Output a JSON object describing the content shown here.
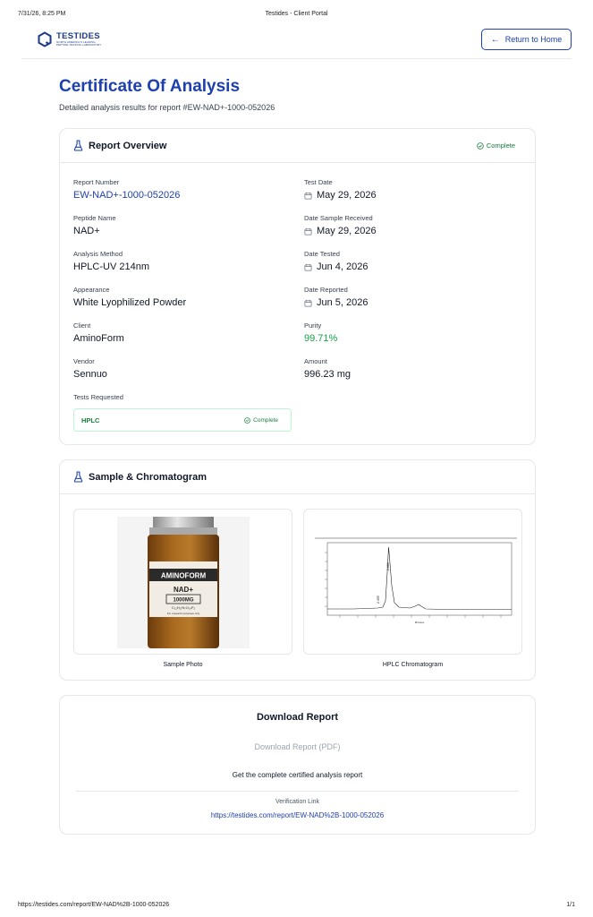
{
  "print": {
    "timestamp": "7/31/26, 8:25 PM",
    "title": "Testides - Client Portal",
    "url": "https://testides.com/report/EW-NAD%2B-1000-052026",
    "page": "1/1"
  },
  "nav": {
    "logo_name": "TESTIDES",
    "logo_tagline_1": "NORTH AMERICA'S LEADING",
    "logo_tagline_2": "PEPTIDE TESTING LABORATORY",
    "return_label": "Return to Home"
  },
  "page": {
    "title": "Certificate Of Analysis",
    "subtitle": "Detailed analysis results for report #EW-NAD+-1000-052026"
  },
  "overview": {
    "title": "Report Overview",
    "status": "Complete",
    "report_number_label": "Report Number",
    "report_number": "EW-NAD+-1000-052026",
    "peptide_label": "Peptide Name",
    "peptide": "NAD+",
    "method_label": "Analysis Method",
    "method": "HPLC-UV 214nm",
    "appearance_label": "Appearance",
    "appearance": "White Lyophilized Powder",
    "client_label": "Client",
    "client": "AminoForm",
    "vendor_label": "Vendor",
    "vendor": "Sennuo",
    "tests_label": "Tests Requested",
    "test_date_label": "Test Date",
    "test_date": "May 29, 2026",
    "received_label": "Date Sample Received",
    "received": "May 29, 2026",
    "tested_label": "Date Tested",
    "tested": "Jun 4, 2026",
    "reported_label": "Date Reported",
    "reported": "Jun 5, 2026",
    "purity_label": "Purity",
    "purity": "99.71%",
    "amount_label": "Amount",
    "amount": "996.23 mg",
    "test": {
      "name": "HPLC",
      "status": "Complete"
    }
  },
  "sample": {
    "title": "Sample & Chromatogram",
    "photo_caption": "Sample Photo",
    "chrom_caption": "HPLC Chromatogram",
    "vial_brand": "AMINOFORM",
    "vial_product": "NAD+",
    "vial_dose": "1000MG",
    "vial_formula": "C₂₁H₂₇N₇O₁₄P₂",
    "vial_note": "For research purposes only",
    "peak_label_main": "2.880",
    "peak_label_minor": "2.459",
    "x_axis_label": "Minutes"
  },
  "download": {
    "title": "Download Report",
    "button": "Download Report (PDF)",
    "description": "Get the complete certified analysis report",
    "verification_label": "Verification Link",
    "verification_url": "https://testides.com/report/EW-NAD%2B-1000-052026"
  },
  "colors": {
    "brand": "#1e40af",
    "success": "#16a34a",
    "border": "#e5e7eb"
  },
  "icons": {
    "back": "arrow-left-icon",
    "flask": "flask-icon",
    "check": "check-circle-icon",
    "calendar": "calendar-icon"
  }
}
